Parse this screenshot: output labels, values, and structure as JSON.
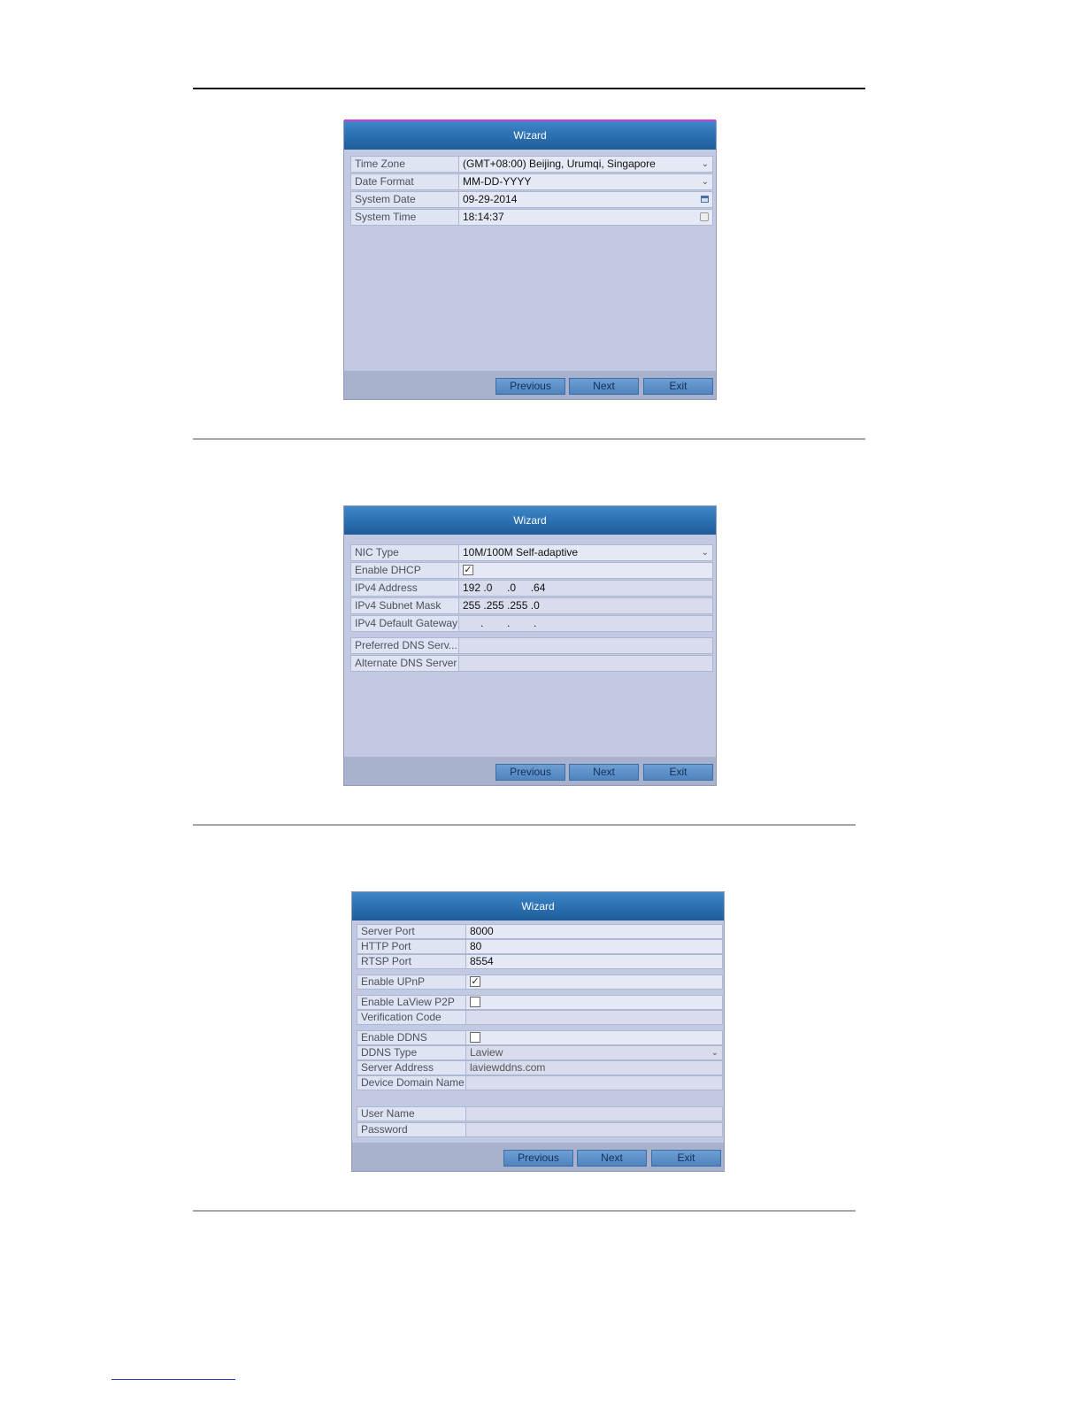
{
  "time_wizard": {
    "title": "Wizard",
    "fields": [
      {
        "label": "Time Zone",
        "value": "(GMT+08:00) Beijing, Urumqi, Singapore"
      },
      {
        "label": "Date Format",
        "value": "MM-DD-YYYY"
      },
      {
        "label": "System Date",
        "value": "09-29-2014"
      },
      {
        "label": "System Time",
        "value": "18:14:37"
      }
    ],
    "buttons": {
      "previous": "Previous",
      "next": "Next",
      "exit": "Exit"
    }
  },
  "network_wizard": {
    "title": "Wizard",
    "fields": [
      {
        "label": "NIC Type",
        "value": "10M/100M Self-adaptive"
      },
      {
        "label": "Enable DHCP",
        "checked": true
      },
      {
        "label": "IPv4 Address",
        "value": "192 .0     .0     .64"
      },
      {
        "label": "IPv4 Subnet Mask",
        "value": "255 .255 .255 .0"
      },
      {
        "label": "IPv4 Default Gateway",
        "value": "      .        .        ."
      },
      {
        "label": "Preferred DNS Serv...",
        "value": ""
      },
      {
        "label": "Alternate DNS Server",
        "value": ""
      }
    ],
    "buttons": {
      "previous": "Previous",
      "next": "Next",
      "exit": "Exit"
    }
  },
  "ports_wizard": {
    "title": "Wizard",
    "fields": [
      {
        "label": "Server Port",
        "value": "8000"
      },
      {
        "label": "HTTP Port",
        "value": "80"
      },
      {
        "label": "RTSP Port",
        "value": "8554"
      },
      {
        "label": "Enable UPnP",
        "checked": true
      },
      {
        "label": "Enable LaView P2P",
        "checked": false
      },
      {
        "label": "Verification Code",
        "value": ""
      },
      {
        "label": "Enable DDNS",
        "checked": false
      },
      {
        "label": "DDNS Type",
        "value": "Laview"
      },
      {
        "label": "Server Address",
        "value": "laviewddns.com"
      },
      {
        "label": "Device Domain Name",
        "value": ""
      },
      {
        "label": "User Name",
        "value": ""
      },
      {
        "label": "Password",
        "value": ""
      }
    ],
    "buttons": {
      "previous": "Previous",
      "next": "Next",
      "exit": "Exit"
    }
  },
  "checkmark": "✓",
  "dropdown_caret": "⌄"
}
